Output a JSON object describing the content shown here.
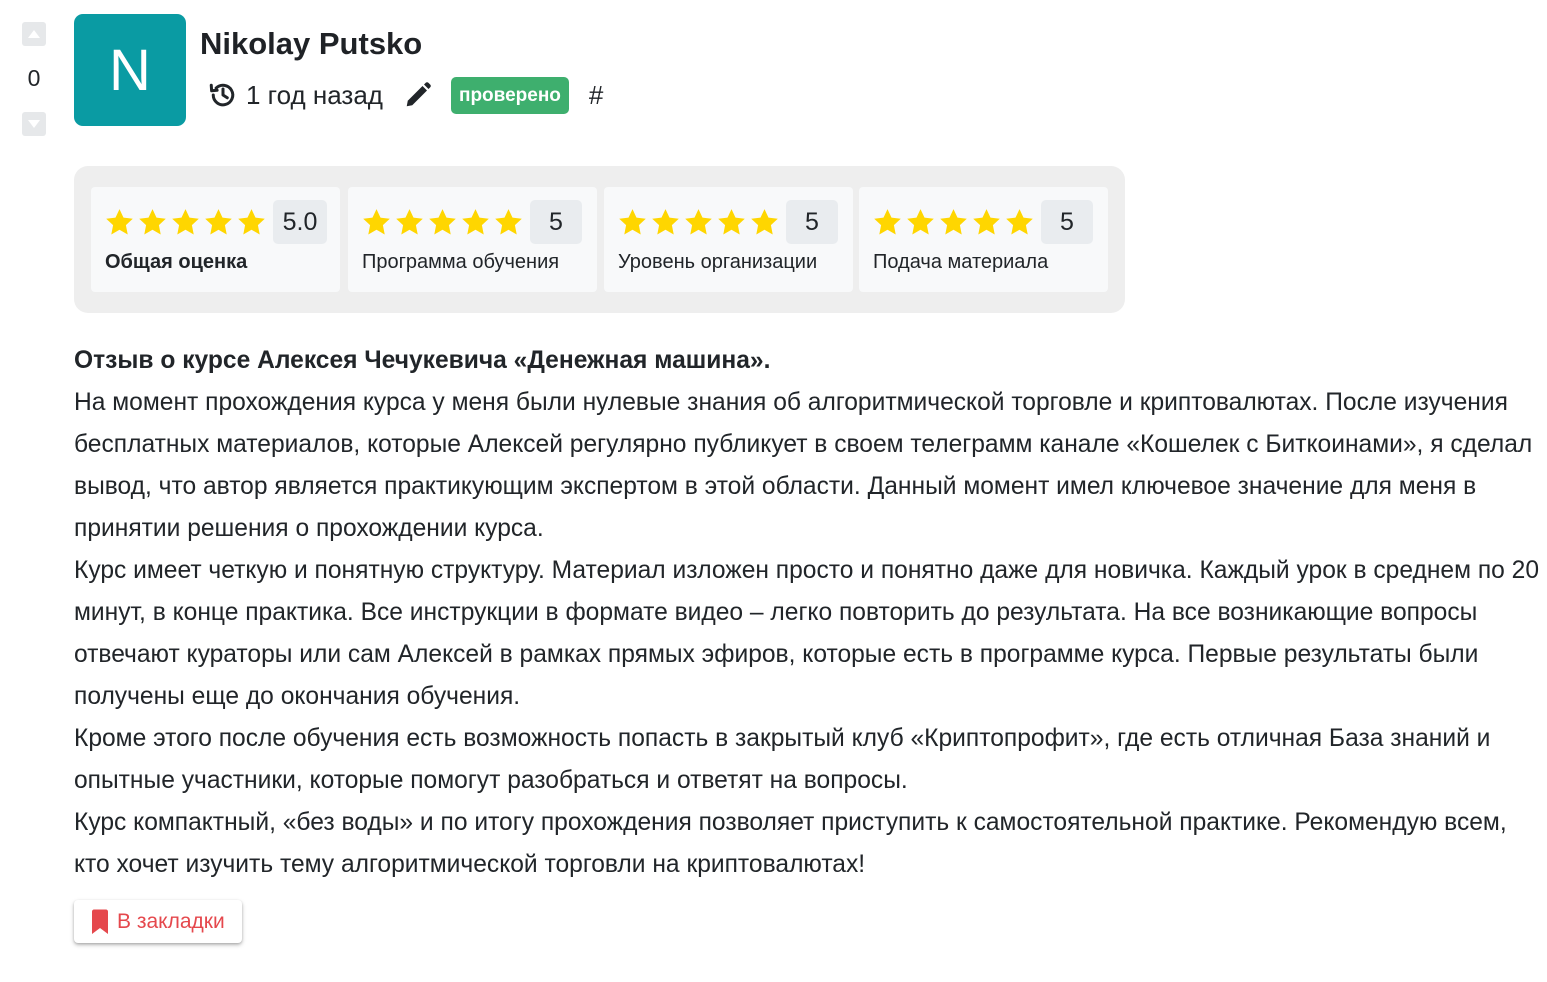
{
  "vote": {
    "count": "0",
    "up_icon": "triangle-up-icon",
    "down_icon": "triangle-down-icon"
  },
  "author": {
    "initial": "N",
    "name": "Nikolay Putsko",
    "avatar_color": "#0a9ba3"
  },
  "meta": {
    "history_icon": "history-icon",
    "time": "1 год назад",
    "edit_icon": "pencil-icon",
    "badge": "проверено",
    "badge_color": "#3eaf6e",
    "anchor": "#"
  },
  "ratings": {
    "star_color": "#ffd600",
    "items": [
      {
        "label": "Общая оценка",
        "score": "5.0",
        "stars": 5
      },
      {
        "label": "Программа обучения",
        "score": "5",
        "stars": 5
      },
      {
        "label": "Уровень организации",
        "score": "5",
        "stars": 5
      },
      {
        "label": "Подача материала",
        "score": "5",
        "stars": 5
      }
    ]
  },
  "review": {
    "title": "Отзыв о курсе Алексея Чечукевича «Денежная машина».",
    "paragraphs": [
      "На момент прохождения курса у меня были нулевые знания об алгоритмической торговле и криптовалютах. После изучения бесплатных материалов, которые Алексей регулярно публикует в своем телеграмм канале «Кошелек с Биткоинами», я сделал вывод, что автор является практикующим экспертом в этой области. Данный момент имел ключевое значение для меня в принятии решения о прохождении курса.",
      "Курс имеет четкую и понятную структуру. Материал изложен просто и понятно даже для новичка. Каждый урок в среднем по 20 минут, в конце практика. Все инструкции в формате видео – легко повторить до результата. На все возникающие вопросы отвечают кураторы или сам Алексей в рамках прямых эфиров, которые есть в программе курса. Первые результаты были получены еще до окончания обучения.",
      "Кроме этого после обучения есть возможность попасть в закрытый клуб «Криптопрофит», где есть отличная База знаний и опытные участники, которые помогут разобраться и ответят на вопросы.",
      "Курс компактный, «без воды» и по итогу прохождения позволяет приступить к самостоятельной практике. Рекомендую всем, кто хочет изучить тему алгоритмической торговли на криптовалютах!"
    ]
  },
  "bookmark": {
    "icon": "bookmark-icon",
    "label": "В закладки",
    "color": "#e5484d"
  }
}
